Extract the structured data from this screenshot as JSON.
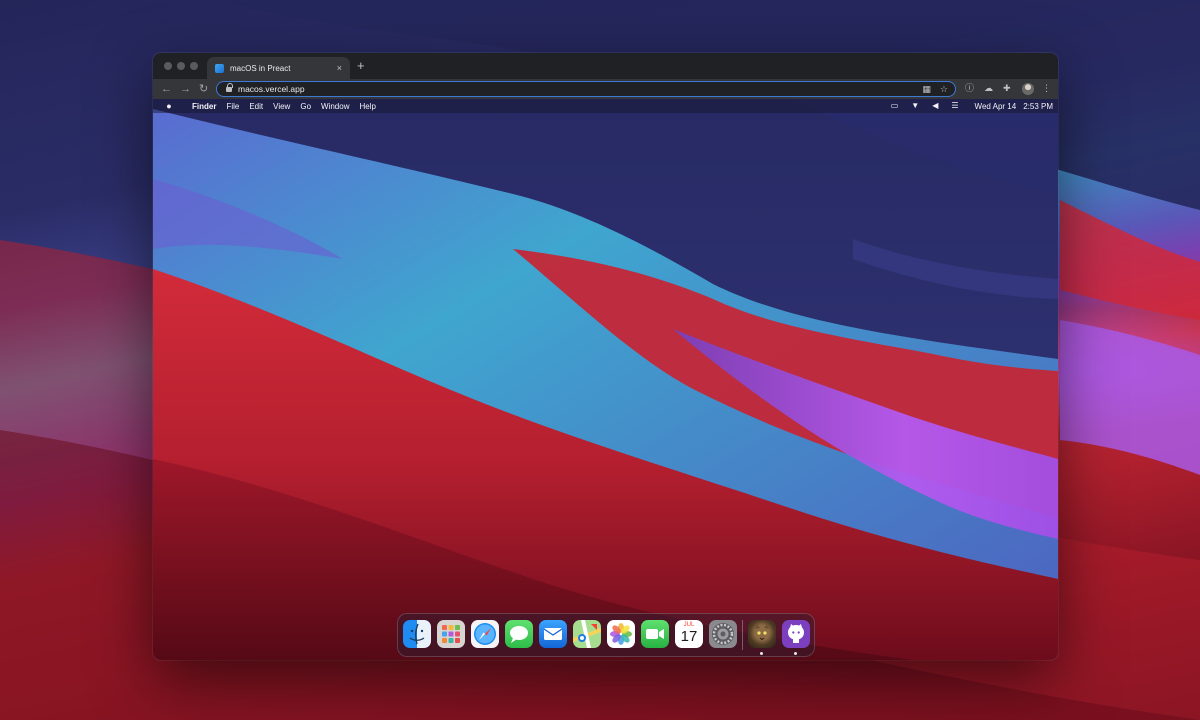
{
  "browser": {
    "tab_title": "macOS in Preact",
    "tab_close": "×",
    "new_tab": "+",
    "url": "macos.vercel.app",
    "back": "←",
    "forward": "→",
    "reload": "↻"
  },
  "menubar": {
    "apple": "",
    "app_name": "Finder",
    "menus": [
      "File",
      "Edit",
      "View",
      "Go",
      "Window",
      "Help"
    ],
    "date": "Wed Apr 14",
    "time": "2:53 PM"
  },
  "dock": {
    "apps": [
      {
        "name": "finder",
        "color": "#1f8ef0"
      },
      {
        "name": "launchpad",
        "color": "#d7d3d0"
      },
      {
        "name": "safari",
        "color": "#f5f5f7"
      },
      {
        "name": "messages",
        "color": "#34c759"
      },
      {
        "name": "mail",
        "color": "#1e7ce8"
      },
      {
        "name": "maps",
        "color": "#8fcf7a"
      },
      {
        "name": "photos",
        "color": "#ffffff"
      },
      {
        "name": "facetime",
        "color": "#30c048"
      },
      {
        "name": "calendar",
        "color": "#ffffff"
      },
      {
        "name": "system-preferences",
        "color": "#8a8a8e"
      },
      {
        "name": "purus-twitter",
        "color": "#6a4e2e"
      },
      {
        "name": "github",
        "color": "#7b3fbf"
      }
    ],
    "calendar_month": "JUL",
    "calendar_day": "17"
  }
}
